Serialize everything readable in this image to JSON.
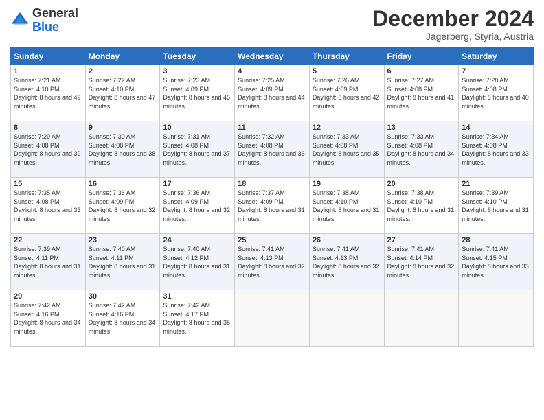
{
  "header": {
    "logo_general": "General",
    "logo_blue": "Blue",
    "month_title": "December 2024",
    "location": "Jagerberg, Styria, Austria"
  },
  "weekdays": [
    "Sunday",
    "Monday",
    "Tuesday",
    "Wednesday",
    "Thursday",
    "Friday",
    "Saturday"
  ],
  "weeks": [
    [
      {
        "day": "1",
        "sunrise": "7:21 AM",
        "sunset": "4:10 PM",
        "daylight": "8 hours and 49 minutes."
      },
      {
        "day": "2",
        "sunrise": "7:22 AM",
        "sunset": "4:10 PM",
        "daylight": "8 hours and 47 minutes."
      },
      {
        "day": "3",
        "sunrise": "7:23 AM",
        "sunset": "4:09 PM",
        "daylight": "8 hours and 45 minutes."
      },
      {
        "day": "4",
        "sunrise": "7:25 AM",
        "sunset": "4:09 PM",
        "daylight": "8 hours and 44 minutes."
      },
      {
        "day": "5",
        "sunrise": "7:26 AM",
        "sunset": "4:09 PM",
        "daylight": "8 hours and 42 minutes."
      },
      {
        "day": "6",
        "sunrise": "7:27 AM",
        "sunset": "4:08 PM",
        "daylight": "8 hours and 41 minutes."
      },
      {
        "day": "7",
        "sunrise": "7:28 AM",
        "sunset": "4:08 PM",
        "daylight": "8 hours and 40 minutes."
      }
    ],
    [
      {
        "day": "8",
        "sunrise": "7:29 AM",
        "sunset": "4:08 PM",
        "daylight": "8 hours and 39 minutes."
      },
      {
        "day": "9",
        "sunrise": "7:30 AM",
        "sunset": "4:08 PM",
        "daylight": "8 hours and 38 minutes."
      },
      {
        "day": "10",
        "sunrise": "7:31 AM",
        "sunset": "4:08 PM",
        "daylight": "8 hours and 37 minutes."
      },
      {
        "day": "11",
        "sunrise": "7:32 AM",
        "sunset": "4:08 PM",
        "daylight": "8 hours and 36 minutes."
      },
      {
        "day": "12",
        "sunrise": "7:33 AM",
        "sunset": "4:08 PM",
        "daylight": "8 hours and 35 minutes."
      },
      {
        "day": "13",
        "sunrise": "7:33 AM",
        "sunset": "4:08 PM",
        "daylight": "8 hours and 34 minutes."
      },
      {
        "day": "14",
        "sunrise": "7:34 AM",
        "sunset": "4:08 PM",
        "daylight": "8 hours and 33 minutes."
      }
    ],
    [
      {
        "day": "15",
        "sunrise": "7:35 AM",
        "sunset": "4:08 PM",
        "daylight": "8 hours and 33 minutes."
      },
      {
        "day": "16",
        "sunrise": "7:36 AM",
        "sunset": "4:09 PM",
        "daylight": "8 hours and 32 minutes."
      },
      {
        "day": "17",
        "sunrise": "7:36 AM",
        "sunset": "4:09 PM",
        "daylight": "8 hours and 32 minutes."
      },
      {
        "day": "18",
        "sunrise": "7:37 AM",
        "sunset": "4:09 PM",
        "daylight": "8 hours and 31 minutes."
      },
      {
        "day": "19",
        "sunrise": "7:38 AM",
        "sunset": "4:10 PM",
        "daylight": "8 hours and 31 minutes."
      },
      {
        "day": "20",
        "sunrise": "7:38 AM",
        "sunset": "4:10 PM",
        "daylight": "8 hours and 31 minutes."
      },
      {
        "day": "21",
        "sunrise": "7:39 AM",
        "sunset": "4:10 PM",
        "daylight": "8 hours and 31 minutes."
      }
    ],
    [
      {
        "day": "22",
        "sunrise": "7:39 AM",
        "sunset": "4:11 PM",
        "daylight": "8 hours and 31 minutes."
      },
      {
        "day": "23",
        "sunrise": "7:40 AM",
        "sunset": "4:11 PM",
        "daylight": "8 hours and 31 minutes."
      },
      {
        "day": "24",
        "sunrise": "7:40 AM",
        "sunset": "4:12 PM",
        "daylight": "8 hours and 31 minutes."
      },
      {
        "day": "25",
        "sunrise": "7:41 AM",
        "sunset": "4:13 PM",
        "daylight": "8 hours and 32 minutes."
      },
      {
        "day": "26",
        "sunrise": "7:41 AM",
        "sunset": "4:13 PM",
        "daylight": "8 hours and 32 minutes."
      },
      {
        "day": "27",
        "sunrise": "7:41 AM",
        "sunset": "4:14 PM",
        "daylight": "8 hours and 32 minutes."
      },
      {
        "day": "28",
        "sunrise": "7:41 AM",
        "sunset": "4:15 PM",
        "daylight": "8 hours and 33 minutes."
      }
    ],
    [
      {
        "day": "29",
        "sunrise": "7:42 AM",
        "sunset": "4:16 PM",
        "daylight": "8 hours and 34 minutes."
      },
      {
        "day": "30",
        "sunrise": "7:42 AM",
        "sunset": "4:16 PM",
        "daylight": "8 hours and 34 minutes."
      },
      {
        "day": "31",
        "sunrise": "7:42 AM",
        "sunset": "4:17 PM",
        "daylight": "8 hours and 35 minutes."
      },
      null,
      null,
      null,
      null
    ]
  ]
}
